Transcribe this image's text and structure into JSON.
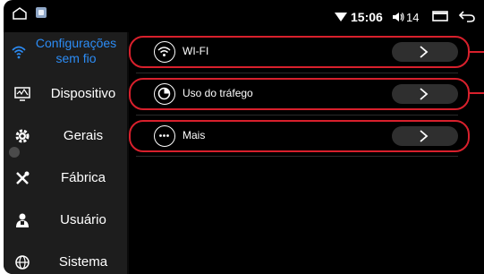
{
  "status_bar": {
    "time": "15:06",
    "volume": "14",
    "icons": [
      "home-icon",
      "app-icon",
      "wifi-signal-icon",
      "volume-icon",
      "window-icon",
      "back-icon"
    ]
  },
  "sidebar": {
    "items": [
      {
        "label_line1": "Configurações",
        "label_line2": "sem fio",
        "icon": "wifi-icon",
        "active": true
      },
      {
        "label": "Dispositivo",
        "icon": "monitor-icon"
      },
      {
        "label": "Gerais",
        "icon": "gear-icon"
      },
      {
        "label": "Fábrica",
        "icon": "tools-icon"
      },
      {
        "label": "Usuário",
        "icon": "user-icon"
      },
      {
        "label": "Sistema",
        "icon": "globe-icon"
      }
    ]
  },
  "main": {
    "rows": [
      {
        "label": "WI-FI",
        "icon": "wifi-icon"
      },
      {
        "label": "Uso do tráfego",
        "icon": "traffic-icon"
      },
      {
        "label": "Mais",
        "icon": "more-icon"
      }
    ]
  },
  "colors": {
    "accent": "#2c8cf5",
    "highlight": "#d8202c",
    "sidebar_bg": "#1d1d1d",
    "background": "#000000"
  }
}
